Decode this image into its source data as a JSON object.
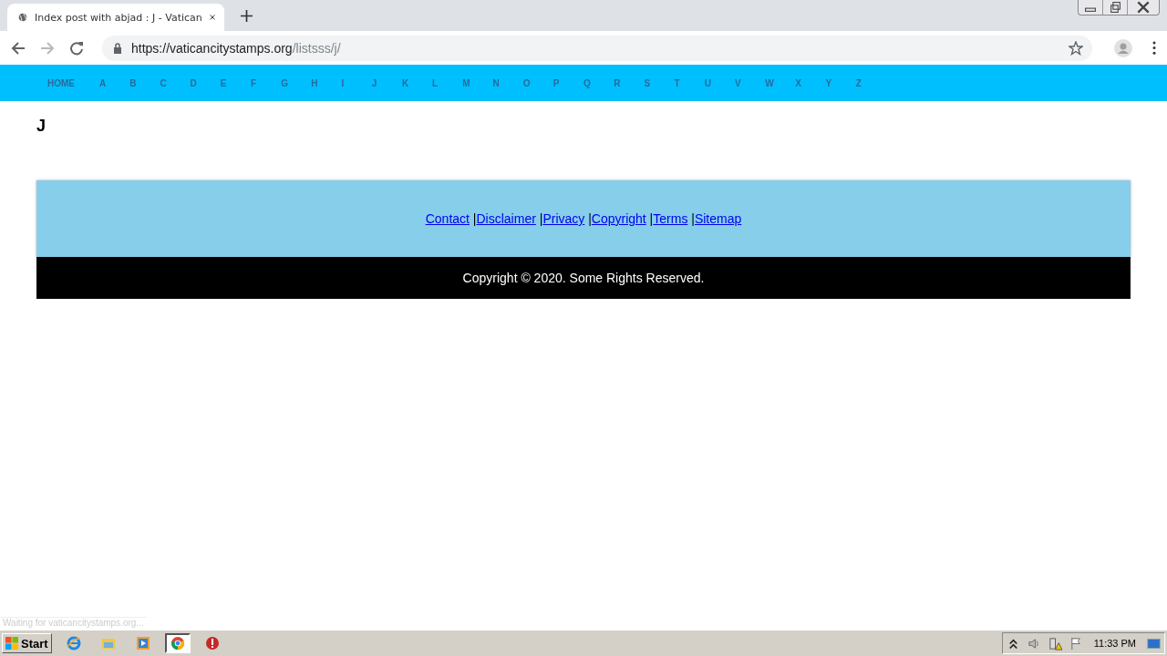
{
  "browser": {
    "tab_title": "Index post with abjad : J - Vatican",
    "url_host": "https://vaticancitystamps.org",
    "url_path": "/listsss/j/",
    "status": "Waiting for vaticancitystamps.org..."
  },
  "nav": [
    "HOME",
    "A",
    "B",
    "C",
    "D",
    "E",
    "F",
    "G",
    "H",
    "I",
    "J",
    "K",
    "L",
    "M",
    "N",
    "O",
    "P",
    "Q",
    "R",
    "S",
    "T",
    "U",
    "V",
    "W",
    "X",
    "Y",
    "Z"
  ],
  "heading": "J",
  "footer": {
    "links": [
      {
        "label": "Contact",
        "separator": "|"
      },
      {
        "label": "Disclaimer",
        "separator": "|"
      },
      {
        "label": "Privacy",
        "separator": "|"
      },
      {
        "label": "Copyright",
        "separator": "|"
      },
      {
        "label": "Terms",
        "separator": "|"
      },
      {
        "label": "Sitemap"
      }
    ],
    "copyright": "Copyright © 2020. Some Rights Reserved."
  },
  "taskbar": {
    "start": "Start",
    "apps": [
      {
        "kind": "ie",
        "selected": false
      },
      {
        "kind": "folder",
        "selected": false
      },
      {
        "kind": "media",
        "selected": false
      },
      {
        "kind": "chrome",
        "selected": true
      },
      {
        "kind": "stop",
        "selected": false
      }
    ],
    "clock": "11:33 PM"
  }
}
